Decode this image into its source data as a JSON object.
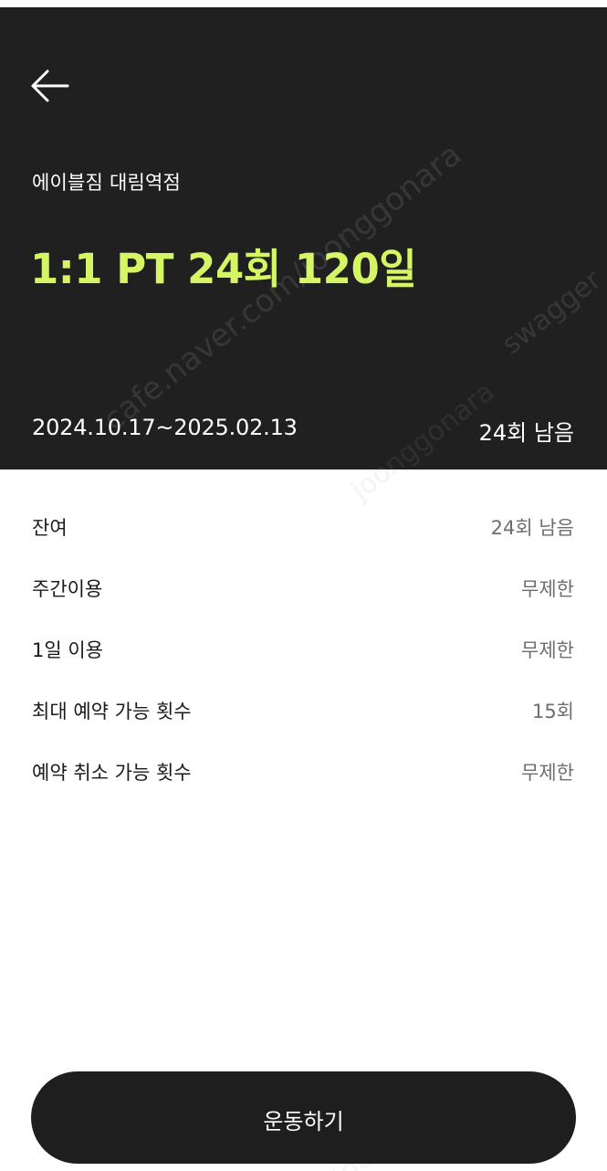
{
  "header": {
    "back_icon": "arrow-left-icon",
    "gym_name": "에이블짐 대림역점",
    "product_title": "1:1 PT 24회 120일",
    "period": "2024.10.17~2025.02.13",
    "remaining": "24회 남음",
    "accent_color": "#d6f564",
    "background_color": "#202020"
  },
  "info": {
    "rows": [
      {
        "label": "잔여",
        "value": "24회 남음"
      },
      {
        "label": "주간이용",
        "value": "무제한"
      },
      {
        "label": "1일 이용",
        "value": "무제한"
      },
      {
        "label": "최대 예약 가능 횟수",
        "value": "15회"
      },
      {
        "label": "예약 취소 가능 횟수",
        "value": "무제한"
      }
    ]
  },
  "cta": {
    "label": "운동하기"
  },
  "watermarks": {
    "wm1": "cafe.naver.com/joonggonara",
    "wm2": "swagger",
    "wm3": "joonggonara",
    "wm4": "joonggonara"
  }
}
